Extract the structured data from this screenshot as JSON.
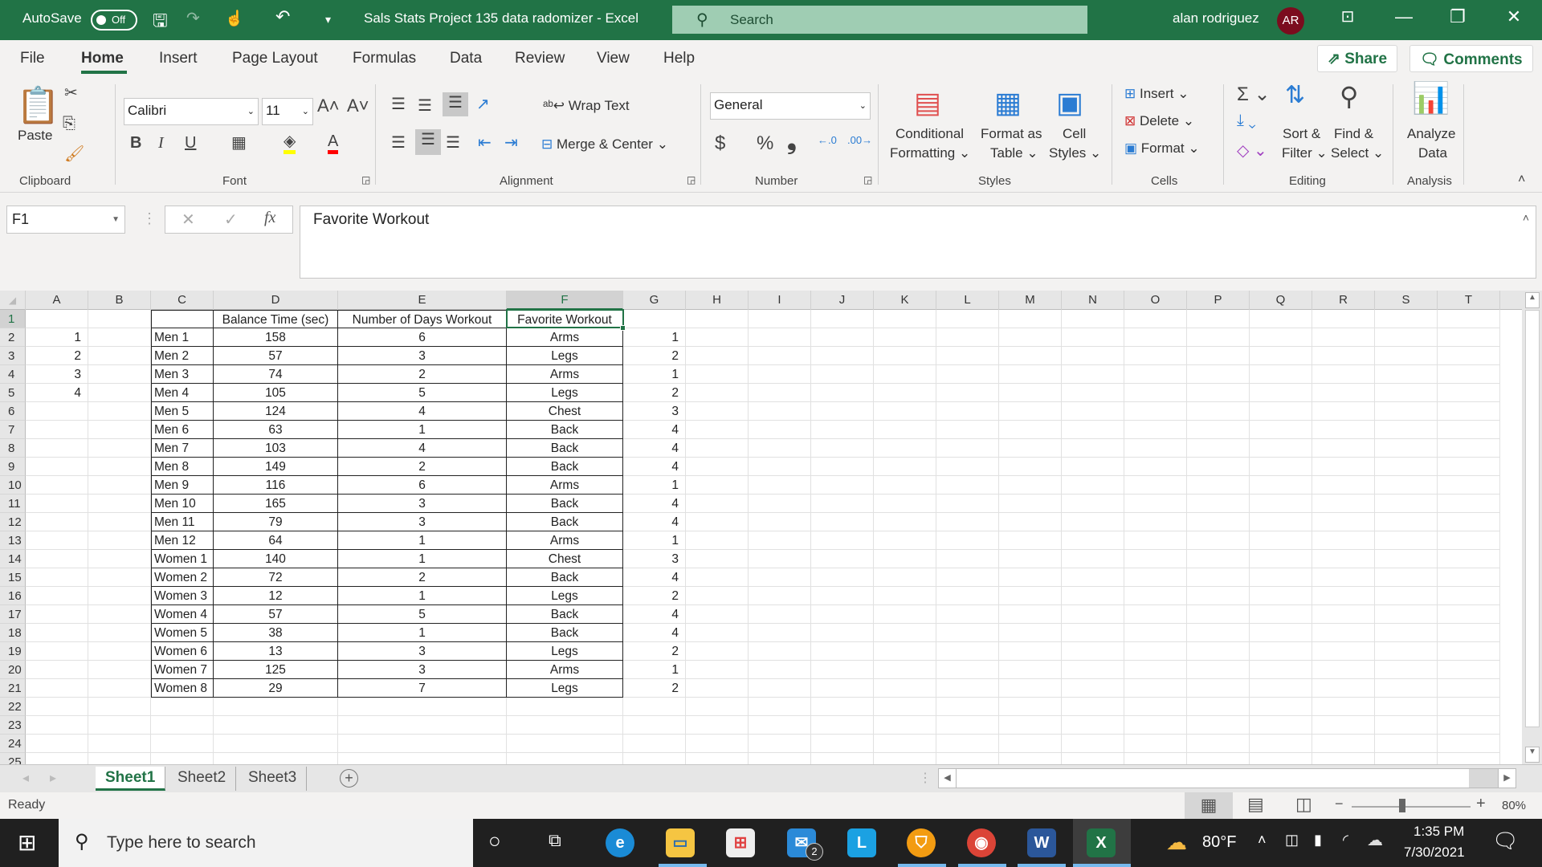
{
  "titlebar": {
    "autosave_label": "AutoSave",
    "autosave_state": "Off",
    "doc_title": "Sals Stats Project 135 data radomizer  -  Excel",
    "search_placeholder": "Search",
    "user_name": "alan rodriguez",
    "user_initials": "AR",
    "minimize": "—",
    "restore": "❐",
    "close": "✕",
    "ribbon_display": "⊡"
  },
  "ribbon_tabs": [
    "File",
    "Home",
    "Insert",
    "Page Layout",
    "Formulas",
    "Data",
    "Review",
    "View",
    "Help"
  ],
  "active_tab": "Home",
  "share_label": "Share",
  "comments_label": "Comments",
  "ribbon": {
    "clipboard": {
      "paste": "Paste",
      "group": "Clipboard"
    },
    "font": {
      "name": "Calibri",
      "size": "11",
      "bold": "B",
      "italic": "I",
      "underline": "U",
      "group": "Font"
    },
    "alignment": {
      "wrap_text": "Wrap Text",
      "merge_center": "Merge & Center",
      "group": "Alignment"
    },
    "number": {
      "format": "General",
      "currency": "$",
      "percent": "%",
      "comma": "❟",
      "group": "Number"
    },
    "styles": {
      "conditional1": "Conditional",
      "conditional2": "Formatting",
      "format_table1": "Format as",
      "format_table2": "Table",
      "cell_styles1": "Cell",
      "cell_styles2": "Styles",
      "group": "Styles"
    },
    "cells": {
      "insert": "Insert",
      "delete": "Delete",
      "format": "Format",
      "group": "Cells"
    },
    "editing": {
      "sort1": "Sort &",
      "sort2": "Filter",
      "find1": "Find &",
      "find2": "Select",
      "group": "Editing"
    },
    "analysis": {
      "analyze1": "Analyze",
      "analyze2": "Data",
      "group": "Analysis"
    }
  },
  "formula_bar": {
    "name_box": "F1",
    "fx": "fx",
    "cancel": "✕",
    "enter": "✓",
    "content": "Favorite Workout"
  },
  "columns": [
    "A",
    "B",
    "C",
    "D",
    "E",
    "F",
    "G",
    "H",
    "I",
    "J",
    "K",
    "L",
    "M",
    "N",
    "O",
    "P",
    "Q",
    "R",
    "S",
    "T"
  ],
  "selected_column": "F",
  "selected_row": 1,
  "row_numbers": [
    1,
    2,
    3,
    4,
    5,
    6,
    7,
    8,
    9,
    10,
    11,
    12,
    13,
    14,
    15,
    16,
    17,
    18,
    19,
    20,
    21,
    22,
    23,
    24,
    25
  ],
  "table": {
    "headers": [
      "",
      "Balance Time (sec)",
      "Number of Days Workout",
      "Favorite Workout"
    ],
    "rows": [
      {
        "a": "1",
        "name": "Men 1",
        "balance": "158",
        "days": "6",
        "workout": "Arms",
        "g": "1"
      },
      {
        "a": "2",
        "name": "Men 2",
        "balance": "57",
        "days": "3",
        "workout": "Legs",
        "g": "2"
      },
      {
        "a": "3",
        "name": "Men 3",
        "balance": "74",
        "days": "2",
        "workout": "Arms",
        "g": "1"
      },
      {
        "a": "4",
        "name": "Men 4",
        "balance": "105",
        "days": "5",
        "workout": "Legs",
        "g": "2"
      },
      {
        "a": "",
        "name": "Men 5",
        "balance": "124",
        "days": "4",
        "workout": "Chest",
        "g": "3"
      },
      {
        "a": "",
        "name": "Men 6",
        "balance": "63",
        "days": "1",
        "workout": "Back",
        "g": "4"
      },
      {
        "a": "",
        "name": "Men 7",
        "balance": "103",
        "days": "4",
        "workout": "Back",
        "g": "4"
      },
      {
        "a": "",
        "name": "Men 8",
        "balance": "149",
        "days": "2",
        "workout": "Back",
        "g": "4"
      },
      {
        "a": "",
        "name": "Men 9",
        "balance": "116",
        "days": "6",
        "workout": "Arms",
        "g": "1"
      },
      {
        "a": "",
        "name": "Men 10",
        "balance": "165",
        "days": "3",
        "workout": "Back",
        "g": "4"
      },
      {
        "a": "",
        "name": "Men 11",
        "balance": "79",
        "days": "3",
        "workout": "Back",
        "g": "4"
      },
      {
        "a": "",
        "name": "Men 12",
        "balance": "64",
        "days": "1",
        "workout": "Arms",
        "g": "1"
      },
      {
        "a": "",
        "name": "Women 1",
        "balance": "140",
        "days": "1",
        "workout": "Chest",
        "g": "3"
      },
      {
        "a": "",
        "name": "Women 2",
        "balance": "72",
        "days": "2",
        "workout": "Back",
        "g": "4"
      },
      {
        "a": "",
        "name": "Women 3",
        "balance": "12",
        "days": "1",
        "workout": "Legs",
        "g": "2"
      },
      {
        "a": "",
        "name": "Women 4",
        "balance": "57",
        "days": "5",
        "workout": "Back",
        "g": "4"
      },
      {
        "a": "",
        "name": "Women 5",
        "balance": "38",
        "days": "1",
        "workout": "Back",
        "g": "4"
      },
      {
        "a": "",
        "name": "Women 6",
        "balance": "13",
        "days": "3",
        "workout": "Legs",
        "g": "2"
      },
      {
        "a": "",
        "name": "Women 7",
        "balance": "125",
        "days": "3",
        "workout": "Arms",
        "g": "1"
      },
      {
        "a": "",
        "name": "Women 8",
        "balance": "29",
        "days": "7",
        "workout": "Legs",
        "g": "2"
      }
    ]
  },
  "sheets": [
    "Sheet1",
    "Sheet2",
    "Sheet3"
  ],
  "active_sheet": "Sheet1",
  "add_sheet": "+",
  "status": {
    "text": "Ready",
    "zoom": "80%",
    "zoom_fraction": 0.4
  },
  "taskbar": {
    "search_placeholder": "Type here to search",
    "weather": "80°F",
    "time": "1:35 PM",
    "date": "7/30/2021",
    "mail_badge": "2"
  },
  "colors": {
    "excel_green": "#217346",
    "avatar": "#7b0c1e"
  }
}
